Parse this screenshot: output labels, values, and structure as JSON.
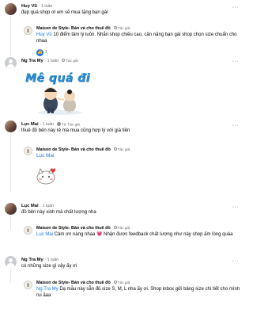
{
  "comments": [
    {
      "name": "Huy Vũ",
      "time": "1 tuần",
      "text": "đẹp quá shop ơi em sẽ mua tặng bạn gái",
      "reply": {
        "name": "Maison de Style- Bán và cho thuê đồ",
        "badge": "Tác giả",
        "mention": "Huy Vũ",
        "text": "10 điểm tâm lý luôn. Nhắn shop chiều cao, cân nặng bạn gái shop chọn size chuẩn cho nhaa",
        "reactions": "1"
      }
    },
    {
      "name": "Ng Tra My",
      "time": "1 tuần",
      "badge": "Tác giả",
      "sticker_text": "Mê quá đi"
    },
    {
      "name": "Lục Mai",
      "time": "1 tuần",
      "badge": "Từ Tác giả",
      "text": "thuê đồ bên này rẻ mà mua cũng hợp lý với giá tiền",
      "reply": {
        "name": "Maison de Style- Bán và cho thuê đồ",
        "badge": "Tác giả",
        "mention": "Lục Mai"
      }
    },
    {
      "name": "Lục Mai",
      "time": "1 tuần",
      "text": "đồ bên này xinh mà chất lượng nha",
      "reply": {
        "name": "Maison de Style- Bán và cho thuê đồ",
        "badge": "Tác giả",
        "mention": "Lục Mai",
        "text": "Cảm ơn nàng nhaa 💗 Nhận được feedback chất lượng như này shop ấm lòng quáa"
      }
    },
    {
      "name": "Ng Tra My",
      "time": "1 tuần",
      "text": "có những size gì vậy ấy ơi",
      "reply": {
        "name": "Maison de Style- Bán và cho thuê đồ",
        "badge": "Tác giả",
        "mention": "Ng Tra My",
        "text": "Dạ mẫu này sẵn đủ size S, M, L nha ấy ơi. Shop inbox gửi bảng size chi tiết cho mình rui ăaa"
      }
    }
  ],
  "colors": {
    "link": "#1877f2",
    "meta": "#65676b",
    "sticker": "#2a8fd6"
  }
}
